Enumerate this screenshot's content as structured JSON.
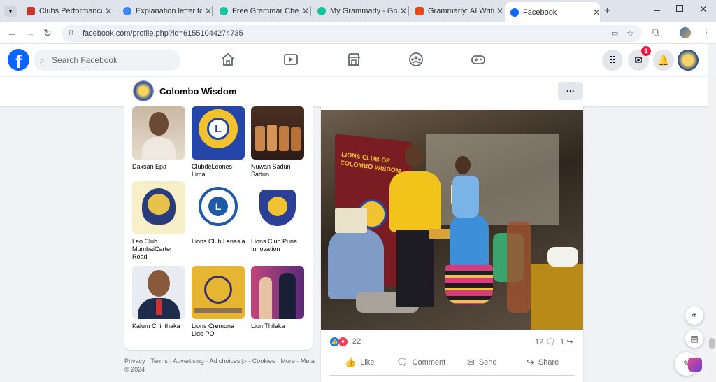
{
  "browser": {
    "tabs": [
      {
        "title": "Clubs Performance E",
        "color": "#c0392b"
      },
      {
        "title": "Explanation letter to",
        "color": "#4285f4"
      },
      {
        "title": "Free Grammar Checke",
        "color": "#15c39a"
      },
      {
        "title": "My Grammarly - Gra",
        "color": "#15c39a"
      },
      {
        "title": "Grammarly: AI Writin",
        "color": "#e64a19"
      },
      {
        "title": "Facebook",
        "color": "#0866ff"
      }
    ],
    "new_tab": "+",
    "url": "facebook.com/profile.php?id=61551044274735"
  },
  "fb": {
    "logo": "f",
    "search_placeholder": "Search Facebook",
    "messenger_badge": "1"
  },
  "profile": {
    "name": "Colombo Wisdom",
    "more": "···"
  },
  "friends": [
    {
      "name": "Daxsan Epa"
    },
    {
      "name": "ClubdeLeones Lima"
    },
    {
      "name": "Nuwan Sadun Sadun"
    },
    {
      "name": "Leo Club MumbaiCarter Road"
    },
    {
      "name": "Lions Club Lenasia"
    },
    {
      "name": "Lions Club Pune Innovation"
    },
    {
      "name": "Kalum Chinthaka"
    },
    {
      "name": "Lions Cremona Lido PO"
    },
    {
      "name": "Lion Thilaka"
    }
  ],
  "footer": "Privacy · Terms · Advertising · Ad choices ▷ · Cookies · More · Meta © 2024",
  "post": {
    "banner_text": "LIONS CLUB OF COLOMBO WISDOM",
    "reactions_count": "22",
    "comments_count": "12",
    "shares_count": "1",
    "actions": {
      "like": "Like",
      "comment": "Comment",
      "send": "Send",
      "share": "Share"
    }
  }
}
